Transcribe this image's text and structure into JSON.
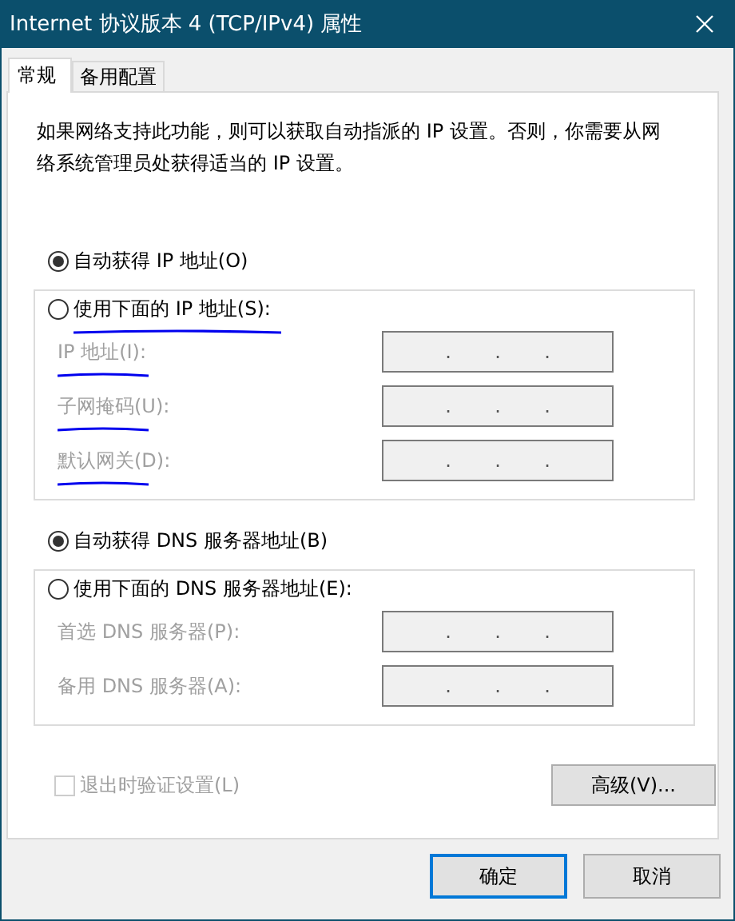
{
  "window": {
    "title": "Internet 协议版本 4 (TCP/IPv4) 属性"
  },
  "tabs": [
    {
      "label": "常规",
      "selected": true
    },
    {
      "label": "备用配置",
      "selected": false
    }
  ],
  "description": "如果网络支持此功能，则可以获取自动指派的 IP 设置。否则，你需要从网络系统管理员处获得适当的 IP 设置。",
  "sections": [
    {
      "auto": {
        "label": "自动获得 IP 地址(O)",
        "selected": true,
        "underlined": false
      },
      "manual": {
        "label": "使用下面的 IP 地址(S):",
        "selected": false,
        "underlined": true
      },
      "fields": [
        {
          "label": "IP 地址(I):",
          "dots": [
            ".",
            ".",
            "."
          ],
          "disabled": true,
          "underlined": true
        },
        {
          "label": "子网掩码(U):",
          "dots": [
            ".",
            ".",
            "."
          ],
          "disabled": true,
          "underlined": true
        },
        {
          "label": "默认网关(D):",
          "dots": [
            ".",
            ".",
            "."
          ],
          "disabled": true,
          "underlined": true
        }
      ]
    },
    {
      "auto": {
        "label": "自动获得 DNS 服务器地址(B)",
        "selected": true,
        "underlined": false
      },
      "manual": {
        "label": "使用下面的 DNS 服务器地址(E):",
        "selected": false,
        "underlined": false
      },
      "fields": [
        {
          "label": "首选 DNS 服务器(P):",
          "dots": [
            ".",
            ".",
            "."
          ],
          "disabled": true,
          "underlined": false
        },
        {
          "label": "备用 DNS 服务器(A):",
          "dots": [
            ".",
            ".",
            "."
          ],
          "disabled": true,
          "underlined": false
        }
      ]
    }
  ],
  "checkbox": {
    "label": "退出时验证设置(L)",
    "checked": false,
    "disabled": true
  },
  "advanced_button": "高级(V)...",
  "buttons": [
    {
      "label": "确定",
      "default": true
    },
    {
      "label": "取消",
      "default": false
    }
  ]
}
